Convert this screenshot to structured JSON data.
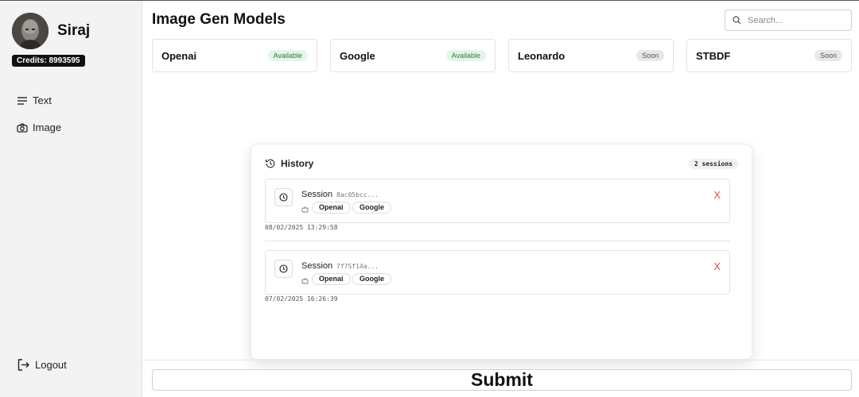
{
  "user": {
    "name": "Siraj",
    "credits_label": "Credits: 8993595"
  },
  "sidebar": {
    "items": [
      {
        "label": "Text",
        "icon": "text-lines-icon"
      },
      {
        "label": "Image",
        "icon": "camera-icon"
      }
    ],
    "logout_label": "Logout"
  },
  "header": {
    "title": "Image Gen Models",
    "search_placeholder": "Search..."
  },
  "models": [
    {
      "name": "Openai",
      "status": "Available"
    },
    {
      "name": "Google",
      "status": "Available"
    },
    {
      "name": "Leonardo",
      "status": "Soon"
    },
    {
      "name": "STBDF",
      "status": "Soon"
    }
  ],
  "history": {
    "title": "History",
    "count_label": "2 sessions",
    "sessions": [
      {
        "label": "Session",
        "id": "8ac05bcc...",
        "models": [
          "Openai",
          "Google"
        ],
        "timestamp": "08/02/2025 13:29:58",
        "close": "X"
      },
      {
        "label": "Session",
        "id": "7f75f14a...",
        "models": [
          "Openai",
          "Google"
        ],
        "timestamp": "07/02/2025 16:26:39",
        "close": "X"
      }
    ]
  },
  "submit_label": "Submit",
  "colors": {
    "available_bg": "#e3f6e9",
    "available_text": "#2f7a45",
    "soon_bg": "#e8e8e8",
    "close_red": "#e24c4c"
  }
}
